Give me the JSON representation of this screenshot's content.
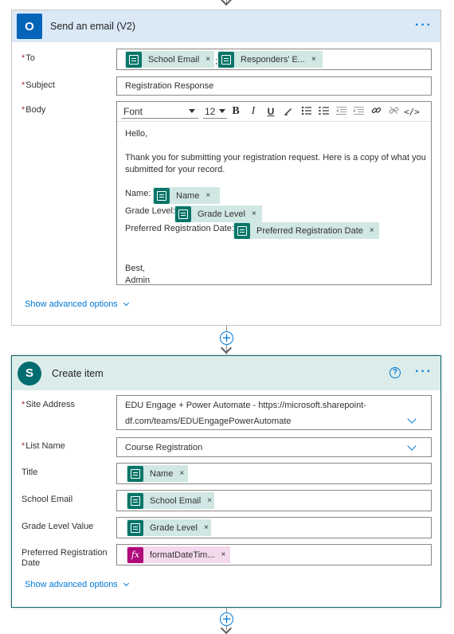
{
  "email_action": {
    "title": "Send an email (V2)",
    "more": "···",
    "to_label": "To",
    "to_tokens": [
      "School Email",
      "Responders' E..."
    ],
    "to_separator": ";",
    "subject_label": "Subject",
    "subject_value": "Registration Response",
    "body_label": "Body",
    "toolbar": {
      "font": "Font",
      "size": "12",
      "bold": "B",
      "italic": "I",
      "underline": "U",
      "code": "</>"
    },
    "body": {
      "greeting": "Hello,",
      "para1_line1": "Thank you for submitting your registration request. Here is a copy of what you",
      "para1_line2": "submitted for your record.",
      "name_label": "Name:",
      "name_token": "Name",
      "grade_label": "Grade Level:",
      "grade_token": "Grade Level",
      "pref_label": "Preferred Registration Date:",
      "pref_token": "Preferred Registration Date",
      "closing": "Best,",
      "signature": "Admin"
    },
    "advanced": "Show advanced options"
  },
  "create_item": {
    "title": "Create item",
    "help": "?",
    "more": "···",
    "site_label": "Site Address",
    "site_value_line1": "EDU Engage + Power Automate - https://microsoft.sharepoint-",
    "site_value_line2": "df.com/teams/EDUEngagePowerAutomate",
    "list_label": "List Name",
    "list_value": "Course Registration",
    "title_label": "Title",
    "title_token": "Name",
    "email_label": "School Email",
    "email_token": "School Email",
    "grade_label": "Grade Level Value",
    "grade_token": "Grade Level",
    "pref_label_line1": "Preferred Registration",
    "pref_label_line2": "Date",
    "pref_token": "formatDateTim...",
    "fx": "fx",
    "advanced": "Show advanced options"
  },
  "icons": {
    "outlook": "O",
    "sharepoint": "S",
    "close": "×",
    "plus": "+"
  },
  "colors": {
    "email_header": "#dbe9f7",
    "sp_header": "#dcecea",
    "token": "#d0e7e4",
    "fx_token": "#f2d9ec",
    "link": "#0078d4"
  }
}
